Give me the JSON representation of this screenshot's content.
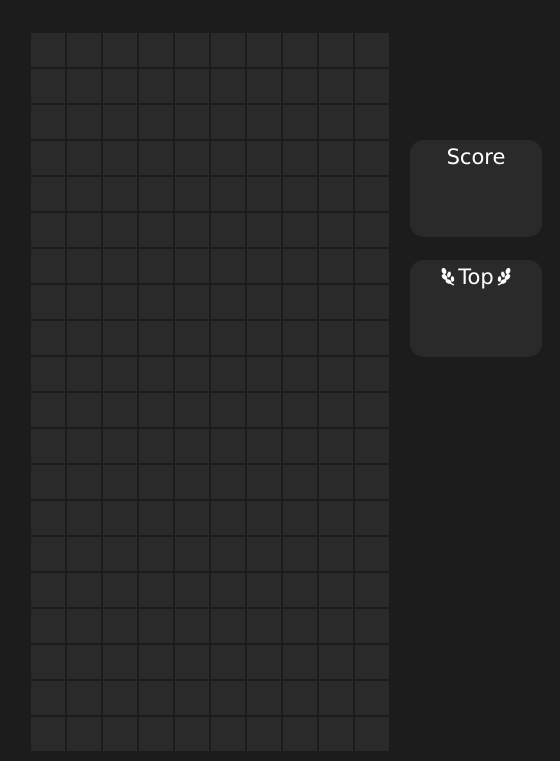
{
  "board": {
    "columns": 10,
    "rows": 20,
    "cell_color": "#2a2a2a",
    "background_color": "#1c1c1c"
  },
  "score_panel": {
    "label": "Score",
    "value": ""
  },
  "top_panel": {
    "label": "Top",
    "value": "",
    "left_icon": "laurel-left-icon",
    "right_icon": "laurel-right-icon"
  }
}
